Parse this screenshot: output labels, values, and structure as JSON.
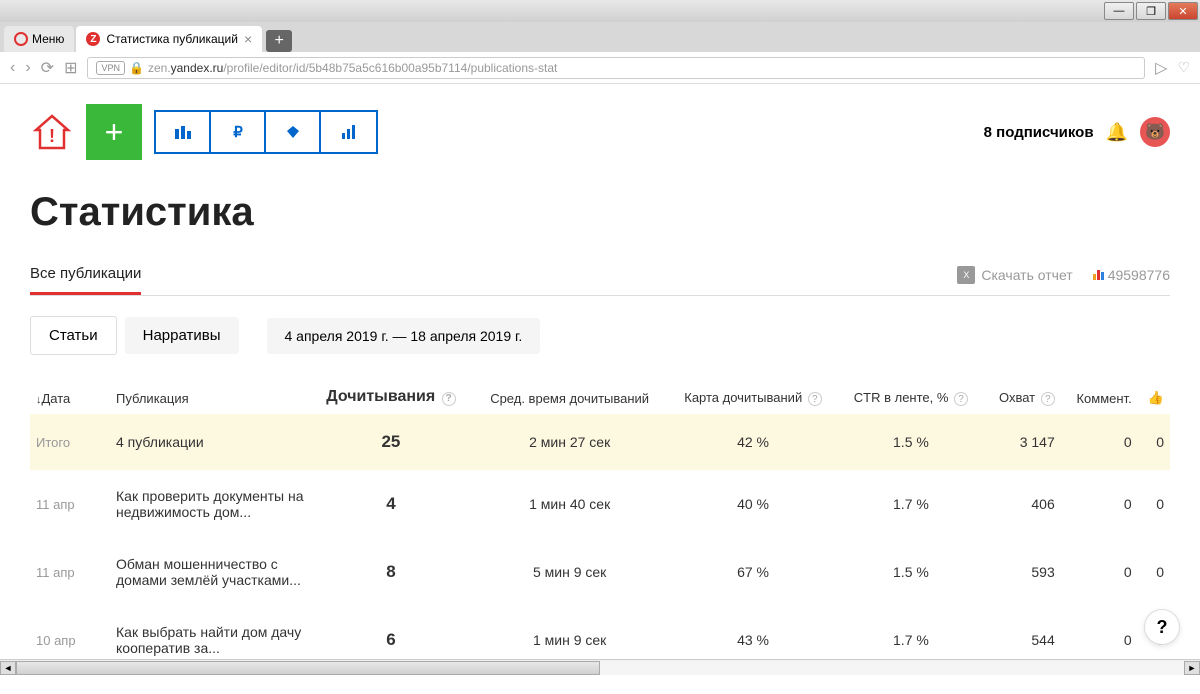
{
  "window": {
    "menu": "Меню",
    "tab_title": "Статистика публикаций",
    "url_prefix": "zen.",
    "url_host": "yandex.ru",
    "url_path": "/profile/editor/id/5b48b75a5c616b00a95b7114/publications-stat",
    "vpn": "VPN"
  },
  "header": {
    "subscribers": "8 подписчиков"
  },
  "page_title": "Статистика",
  "tabs": {
    "all_pubs": "Все публикации",
    "download": "Скачать отчет",
    "metric_id": "49598776"
  },
  "filters": {
    "articles": "Статьи",
    "narratives": "Нарративы",
    "date_range": "4 апреля 2019 г.   —   18 апреля 2019 г."
  },
  "columns": {
    "date": "Дата",
    "publication": "Публикация",
    "reads": "Дочитывания",
    "avg_time": "Сред. время дочитываний",
    "read_map": "Карта дочитываний",
    "ctr": "CTR в ленте, %",
    "reach": "Охват",
    "comments": "Коммент."
  },
  "total": {
    "label": "Итого",
    "pubs": "4 публикации",
    "reads": "25",
    "avg_time": "2 мин 27 сек",
    "read_map": "42 %",
    "ctr": "1.5 %",
    "reach": "3 147",
    "comments": "0",
    "likes": "0"
  },
  "rows": [
    {
      "date": "11 апр",
      "title": "Как проверить документы на недвижимость дом...",
      "reads": "4",
      "avg_time": "1 мин 40 сек",
      "read_map": "40 %",
      "ctr": "1.7 %",
      "reach": "406",
      "comments": "0",
      "likes": "0"
    },
    {
      "date": "11 апр",
      "title": "Обман мошенничество с домами землёй участками...",
      "reads": "8",
      "avg_time": "5 мин 9 сек",
      "read_map": "67 %",
      "ctr": "1.5 %",
      "reach": "593",
      "comments": "0",
      "likes": "0"
    },
    {
      "date": "10 апр",
      "title": "Как выбрать найти дом дачу кооператив за...",
      "reads": "6",
      "avg_time": "1 мин 9 сек",
      "read_map": "43 %",
      "ctr": "1.7 %",
      "reach": "544",
      "comments": "0",
      "likes": "0"
    }
  ]
}
